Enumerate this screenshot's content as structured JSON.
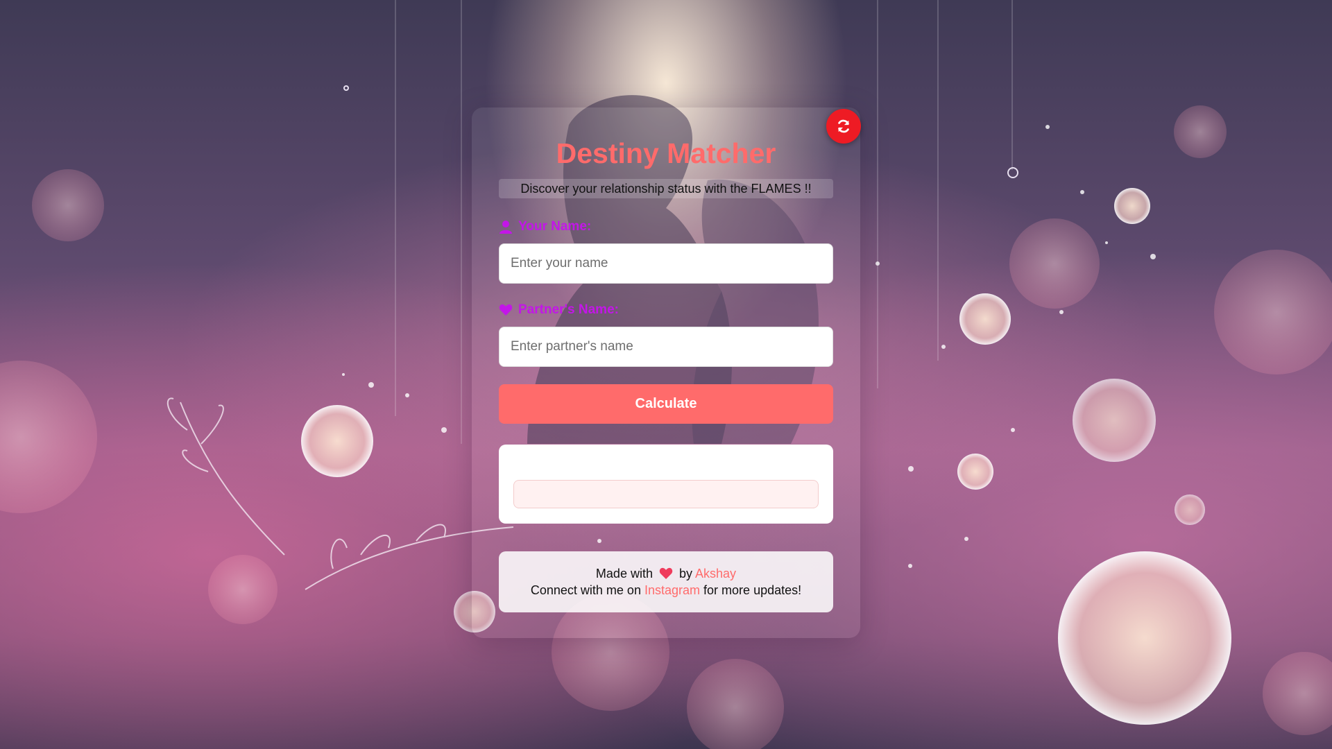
{
  "app": {
    "title": "Destiny Matcher",
    "subtitle": "Discover your relationship status with the FLAMES !!"
  },
  "form": {
    "your_name_label": "Your Name:",
    "your_name_placeholder": "Enter your name",
    "your_name_value": "",
    "partner_name_label": "Partner's Name:",
    "partner_name_placeholder": "Enter partner's name",
    "partner_name_value": "",
    "calculate_label": "Calculate"
  },
  "result": {
    "heading": "",
    "text": ""
  },
  "footer": {
    "made_with": "Made with",
    "by": "by",
    "author": "Akshay",
    "connect_prefix": "Connect with me on",
    "instagram": "Instagram",
    "connect_suffix": "for more updates!"
  },
  "icons": {
    "reset": "refresh-icon",
    "your_name": "user-icon",
    "partner_name": "heart-icon",
    "footer_heart": "heart-icon"
  },
  "colors": {
    "accent": "#ff6b6b",
    "label": "#c316e8",
    "reset_button": "#ee1b24"
  }
}
